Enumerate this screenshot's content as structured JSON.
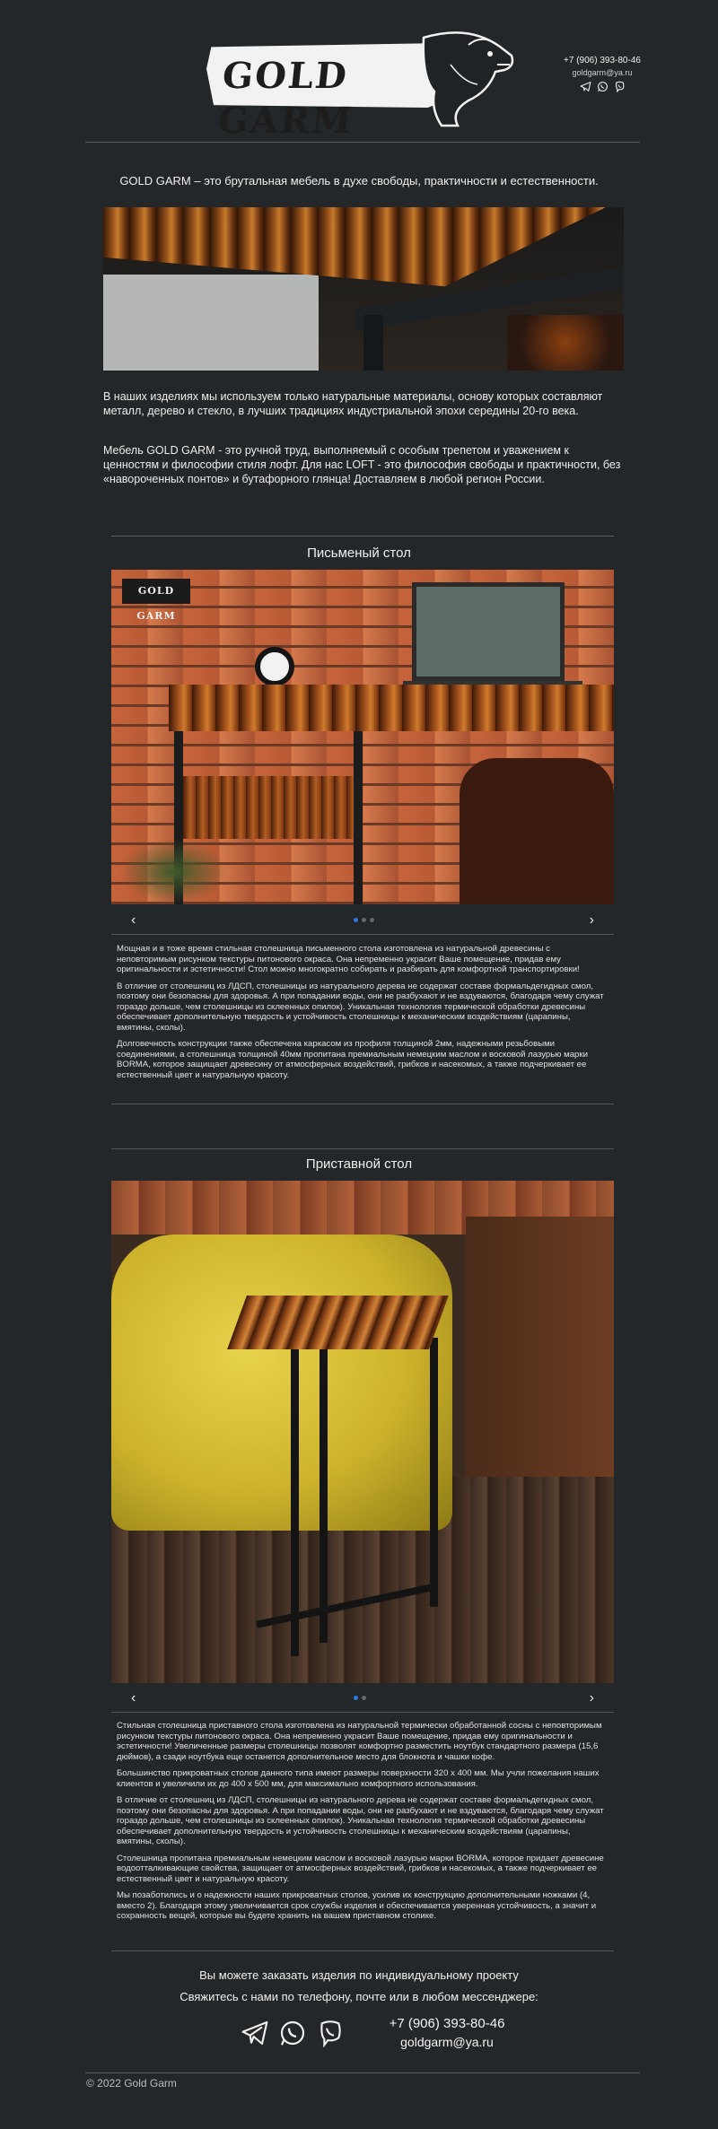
{
  "header": {
    "logo_text": "GOLD GARM",
    "phone": "+7 (906) 393-80-46",
    "email": "goldgarm@ya.ru",
    "icons": [
      "telegram-icon",
      "whatsapp-icon",
      "viber-icon"
    ]
  },
  "intro": "GOLD GARM – это брутальная мебель в духе свободы, практичности и естественности.",
  "about": {
    "p1": "В наших изделиях мы используем только натуральные материалы, основу которых составляют металл, дерево и стекло, в лучших традициях индустриальной эпохи середины 20-го века.",
    "p2": "Мебель GOLD GARM - это ручной труд, выполняемый с особым трепетом и уважением к ценностям и философии стиля лофт. Для нас LOFT - это философия свободы и практичности, без «навороченных понтов» и бутафорного глянца! Доставляем в любой регион России."
  },
  "desk": {
    "title": "Письменый стол",
    "photo_logo": "GOLD GARM",
    "paragraphs": [
      "Мощная и в тоже время стильная столешница письменного стола изготовлена из натуральной древесины с неповторимым рисунком текстуры питонового окраса. Она непременно украсит Ваше помещение, придав ему оригинальности и эстетичности! Стол можно многократно собирать и разбирать для комфортной транспортировки!",
      "В отличие от столешниц из ЛДСП, столешницы из натурального дерева не содержат составе формальдегидных смол, поэтому они безопасны для здоровья. А при попадании воды, они не разбухают и не вздуваются, благодаря чему служат гораздо дольше, чем столешницы из склеенных опилок). Уникальная технология термической обработки древесины обеспечивает дополнительную твердость и устойчивость столешницы к механическим воздействиям (царапины, вмятины, сколы).",
      "Долговечность конструкции также обеспечена каркасом из профиля толщиной 2мм, надежными резьбовыми соединениями, а столешница толщиной 40мм пропитана премиальным немецким маслом и восковой лазурью марки BORMA, которое защищает древесину от атмосферных воздействий, грибков и насекомых, а также подчеркивает ее естественный цвет и натуральную красоту."
    ]
  },
  "side_table": {
    "title": "Приставной стол",
    "paragraphs": [
      "Стильная столешница приставного стола изготовлена из натуральной термически обработанной сосны с неповторимым рисунком текстуры питонового окраса. Она непременно украсит Ваше помещение, придав ему оригинальности и эстетичности! Увеличенные размеры столешницы позволят комфортно разместить ноутбук стандартного размера (15,6 дюймов), а сзади ноутбука еще останется дополнительное место для блокнота и чашки кофе.",
      "Большинство прикроватных столов данного типа имеют размеры поверхности 320 х 400 мм. Мы учли пожелания наших клиентов и увеличили их до 400 х 500 мм, для максимально комфортного использования.",
      "В отличие от столешниц из ЛДСП, столешницы из натурального дерева не содержат составе формальдегидных смол, поэтому они безопасны для здоровья. А при попадании воды, они не разбухают и не вздуваются, благодаря чему служат гораздо дольше, чем столешницы из склеенных опилок). Уникальная технология термической обработки древесины обеспечивает дополнительную твердость и устойчивость столешницы к механическим воздействиям (царапины, вмятины, сколы).",
      "Столешница пропитана премиальным немецким маслом и восковой лазурью марки BORMA, которое придает древесине водоотталкивающие свойства, защищает от атмосферных воздействий, грибков и насекомых, а также подчеркивает ее естественный цвет и натуральную красоту.",
      "Мы позаботились и о надежности наших прикроватных столов, усилив их конструкцию дополнительными ножками (4, вместо 2). Благодаря этому увеличивается срок службы изделия и обеспечивается уверенная устойчивость, а значит и сохранность вещей, которые вы будете хранить на вашем приставном столике."
    ]
  },
  "cta": {
    "line1": "Вы можете заказать изделия по индивидуальному проекту",
    "line2": "Свяжитесь с нами по телефону, почте или в любом мессенджере:",
    "phone": "+7 (906) 393-80-46",
    "email": "goldgarm@ya.ru"
  },
  "footer": {
    "copyright": "© 2022 Gold Garm"
  },
  "colors": {
    "background": "#232729",
    "accent_dot": "#2a7bdc",
    "text": "#e6e6e6"
  }
}
